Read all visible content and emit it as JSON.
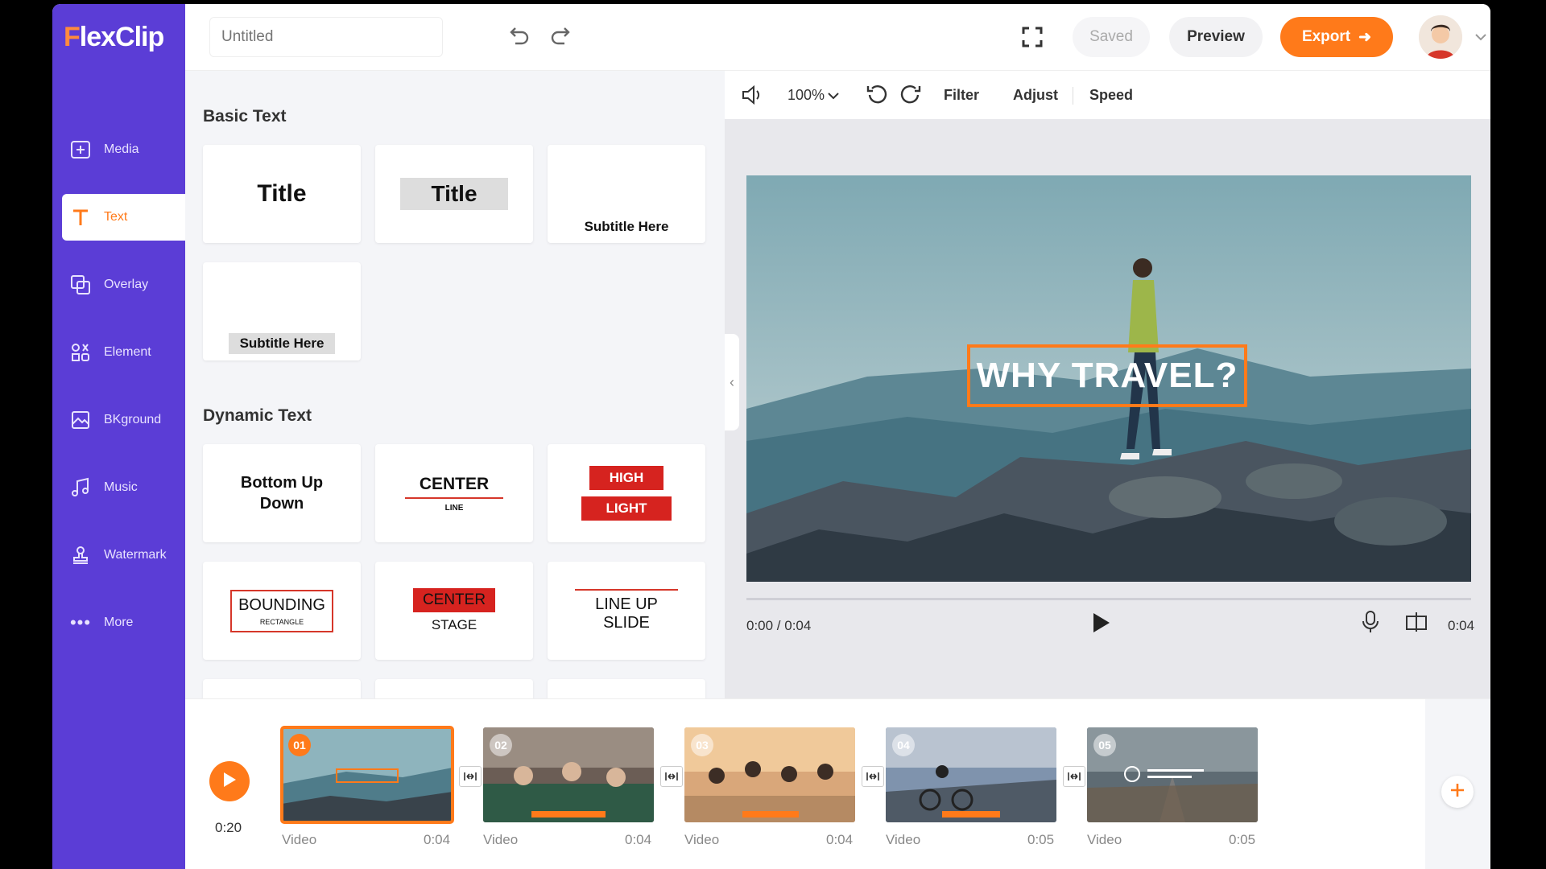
{
  "app": {
    "logo_f": "F",
    "logo_rest": "lexClip"
  },
  "sidebar": {
    "items": [
      {
        "label": "Media",
        "icon": "media-icon"
      },
      {
        "label": "Text",
        "icon": "text-icon"
      },
      {
        "label": "Overlay",
        "icon": "overlay-icon"
      },
      {
        "label": "Element",
        "icon": "element-icon"
      },
      {
        "label": "BKground",
        "icon": "background-icon"
      },
      {
        "label": "Music",
        "icon": "music-icon"
      },
      {
        "label": "Watermark",
        "icon": "watermark-icon"
      },
      {
        "label": "More",
        "icon": "more-icon"
      }
    ],
    "active_index": 1
  },
  "topbar": {
    "title_placeholder": "Untitled",
    "saved_label": "Saved",
    "preview_label": "Preview",
    "export_label": "Export"
  },
  "panel": {
    "basic_title": "Basic Text",
    "basic_cards": [
      "Title",
      "Title",
      "Subtitle Here",
      "Subtitle Here"
    ],
    "dynamic_title": "Dynamic Text",
    "dynamic_cards": {
      "bottom_up": "Bottom Up Down",
      "center_main": "CENTER",
      "center_sub": "LINE",
      "high": "HIGH",
      "light": "LIGHT",
      "bounding_main": "BOUNDING",
      "bounding_sub": "RECTANGLE",
      "center_stage_1": "CENTER",
      "center_stage_2": "STAGE",
      "line_up_1": "LINE UP",
      "line_up_2": "SLIDE"
    }
  },
  "editor": {
    "zoom": "100%",
    "filter_label": "Filter",
    "adjust_label": "Adjust",
    "speed_label": "Speed",
    "overlay_text": "WHY TRAVEL?",
    "time_position": "0:00 / 0:04",
    "duration": "0:04"
  },
  "timeline": {
    "total_time": "0:20",
    "clips": [
      {
        "num": "01",
        "label": "Video",
        "duration": "0:04"
      },
      {
        "num": "02",
        "label": "Video",
        "duration": "0:04"
      },
      {
        "num": "03",
        "label": "Video",
        "duration": "0:04"
      },
      {
        "num": "04",
        "label": "Video",
        "duration": "0:05"
      },
      {
        "num": "05",
        "label": "Video",
        "duration": "0:05"
      }
    ]
  },
  "colors": {
    "brand": "#5b3dd6",
    "accent": "#ff7a1a"
  }
}
